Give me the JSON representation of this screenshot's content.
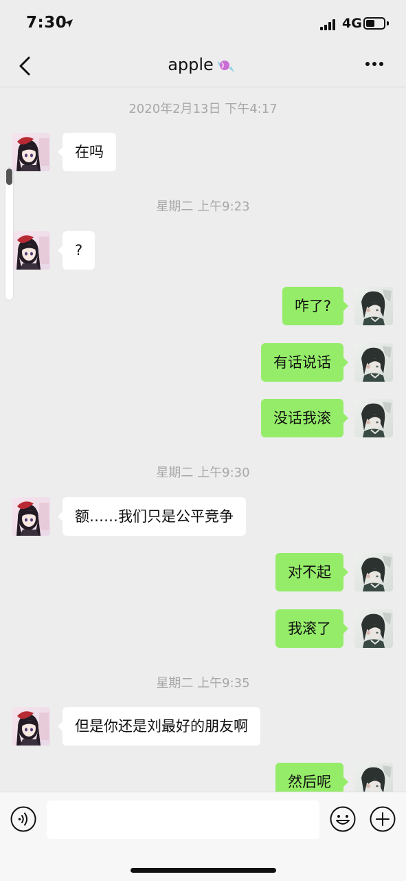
{
  "status_bar": {
    "time": "7:30",
    "network": "4G",
    "signal_bars": 4,
    "battery_level": 0.5
  },
  "header": {
    "back_icon": "chevron-left-icon",
    "title": "apple",
    "title_emoji": "candy",
    "more_icon": "more-dots-icon"
  },
  "chat": {
    "timestamps": [
      "2020年2月13日 下午4:17",
      "星期二 上午9:23",
      "星期二 上午9:30",
      "星期二 上午9:35"
    ],
    "messages": [
      {
        "side": "left",
        "text": "在吗"
      },
      {
        "side": "left",
        "text": "?"
      },
      {
        "side": "right",
        "text": "咋了?"
      },
      {
        "side": "right",
        "text": "有话说话"
      },
      {
        "side": "right",
        "text": "没话我滚"
      },
      {
        "side": "left",
        "text": "额……我们只是公平竞争"
      },
      {
        "side": "right",
        "text": "对不起"
      },
      {
        "side": "right",
        "text": "我滚了"
      },
      {
        "side": "left",
        "text": "但是你还是刘最好的朋友啊"
      },
      {
        "side": "right",
        "text": "然后呢"
      }
    ]
  },
  "input_bar": {
    "voice_icon": "voice-icon",
    "input_value": "",
    "emoji_icon": "emoji-icon",
    "plus_icon": "plus-icon"
  },
  "colors": {
    "background": "#ededed",
    "sent_bubble": "#95ec69",
    "received_bubble": "#ffffff",
    "timestamp_text": "#a8a8a8"
  }
}
